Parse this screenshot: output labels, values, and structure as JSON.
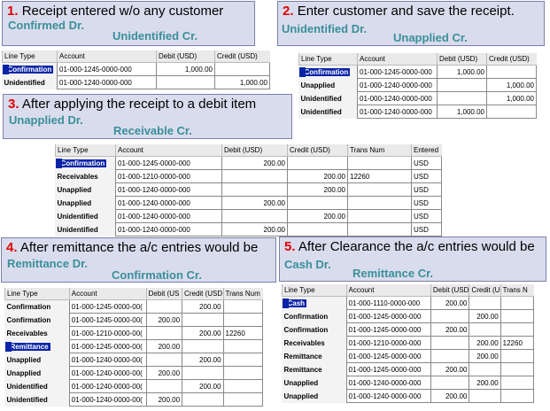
{
  "panels": [
    {
      "step": "1.",
      "title": "Receipt entered w/o any customer",
      "dr": "Confirmed Dr.",
      "cr": "Unidentified Cr.",
      "columns": [
        "Line Type",
        "Account",
        "Debit (USD)",
        "Credit (USD)"
      ],
      "rows": [
        {
          "line_type": "Confirmation",
          "account": "01-000-1245-0000-000",
          "debit": "1,000.00",
          "credit": ""
        },
        {
          "line_type": "Unidentified",
          "account": "01-000-1240-0000-000",
          "debit": "",
          "credit": "1,000.00"
        }
      ]
    },
    {
      "step": "2.",
      "title": "Enter customer and save the receipt.",
      "dr": "Unidentified Dr.",
      "cr": "Unapplied Cr.",
      "columns": [
        "Line Type",
        "Account",
        "Debit (USD)",
        "Credit (USD)"
      ],
      "rows": [
        {
          "line_type": "Confirmation",
          "account": "01-000-1245-0000-000",
          "debit": "1,000.00",
          "credit": ""
        },
        {
          "line_type": "Unapplied",
          "account": "01-000-1240-0000-000",
          "debit": "",
          "credit": "1,000.00"
        },
        {
          "line_type": "Unidentified",
          "account": "01-000-1240-0000-000",
          "debit": "",
          "credit": "1,000.00"
        },
        {
          "line_type": "Unidentified",
          "account": "01-000-1240-0000-000",
          "debit": "1,000.00",
          "credit": ""
        }
      ]
    },
    {
      "step": "3.",
      "title": "After applying the receipt to a debit item",
      "dr": "Unapplied Dr.",
      "cr": "Receivable Cr.",
      "columns": [
        "Line Type",
        "Account",
        "Debit (USD)",
        "Credit (USD)",
        "Trans Num",
        "Entered"
      ],
      "rows": [
        {
          "line_type": "Confirmation",
          "account": "01-000-1245-0000-000",
          "debit": "200.00",
          "credit": "",
          "trans": "",
          "entered": "USD"
        },
        {
          "line_type": "Receivables",
          "account": "01-000-1210-0000-000",
          "debit": "",
          "credit": "200.00",
          "trans": "12260",
          "entered": "USD"
        },
        {
          "line_type": "Unapplied",
          "account": "01-000-1240-0000-000",
          "debit": "",
          "credit": "200.00",
          "trans": "",
          "entered": "USD"
        },
        {
          "line_type": "Unapplied",
          "account": "01-000-1240-0000-000",
          "debit": "200.00",
          "credit": "",
          "trans": "",
          "entered": "USD"
        },
        {
          "line_type": "Unidentified",
          "account": "01-000-1240-0000-000",
          "debit": "",
          "credit": "200.00",
          "trans": "",
          "entered": "USD"
        },
        {
          "line_type": "Unidentified",
          "account": "01-000-1240-0000-000",
          "debit": "200.00",
          "credit": "",
          "trans": "",
          "entered": "USD"
        }
      ]
    },
    {
      "step": "4.",
      "title": "After remittance the a/c entries would be",
      "dr": "Remittance Dr.",
      "cr": "Confirmation Cr.",
      "columns": [
        "Line Type",
        "Account",
        "Debit (US",
        "Credit (USD",
        "Trans Num"
      ],
      "rows": [
        {
          "line_type": "Confirmation",
          "account": "01-000-1245-0000-00(",
          "debit": "",
          "credit": "200.00",
          "trans": ""
        },
        {
          "line_type": "Confirmation",
          "account": "01-000-1245-0000-00(",
          "debit": "200.00",
          "credit": "",
          "trans": ""
        },
        {
          "line_type": "Receivables",
          "account": "01-000-1210-0000-00(",
          "debit": "",
          "credit": "200.00",
          "trans": "12260"
        },
        {
          "line_type": "Remittance",
          "account": "01-000-1245-0000-00(",
          "debit": "200.00",
          "credit": "",
          "trans": ""
        },
        {
          "line_type": "Unapplied",
          "account": "01-000-1240-0000-00(",
          "debit": "",
          "credit": "200.00",
          "trans": ""
        },
        {
          "line_type": "Unapplied",
          "account": "01-000-1240-0000-00(",
          "debit": "200.00",
          "credit": "",
          "trans": ""
        },
        {
          "line_type": "Unidentified",
          "account": "01-000-1240-0000-00(",
          "debit": "",
          "credit": "200.00",
          "trans": ""
        },
        {
          "line_type": "Unidentified",
          "account": "01-000-1240-0000-00(",
          "debit": "200.00",
          "credit": "",
          "trans": ""
        }
      ]
    },
    {
      "step": "5.",
      "title": "After Clearance the a/c entries would be",
      "dr": "Cash Dr.",
      "cr": "Remittance Cr.",
      "columns": [
        "Line Type",
        "Account",
        "Debit (USD",
        "Credit (U",
        "Trans N"
      ],
      "rows": [
        {
          "line_type": "Cash",
          "account": "01-000-1110-0000-000",
          "debit": "200.00",
          "credit": "",
          "trans": ""
        },
        {
          "line_type": "Confirmation",
          "account": "01-000-1245-0000-000",
          "debit": "",
          "credit": "200.00",
          "trans": ""
        },
        {
          "line_type": "Confirmation",
          "account": "01-000-1245-0000-000",
          "debit": "200.00",
          "credit": "",
          "trans": ""
        },
        {
          "line_type": "Receivables",
          "account": "01-000-1210-0000-000",
          "debit": "",
          "credit": "200.00",
          "trans": "12260"
        },
        {
          "line_type": "Remittance",
          "account": "01-000-1245-0000-000",
          "debit": "",
          "credit": "200.00",
          "trans": ""
        },
        {
          "line_type": "Remittance",
          "account": "01-000-1245-0000-000",
          "debit": "200.00",
          "credit": "",
          "trans": ""
        },
        {
          "line_type": "Unapplied",
          "account": "01-000-1240-0000-000",
          "debit": "",
          "credit": "200.00",
          "trans": ""
        },
        {
          "line_type": "Unapplied",
          "account": "01-000-1240-0000-000",
          "debit": "200.00",
          "credit": "",
          "trans": ""
        }
      ]
    }
  ]
}
